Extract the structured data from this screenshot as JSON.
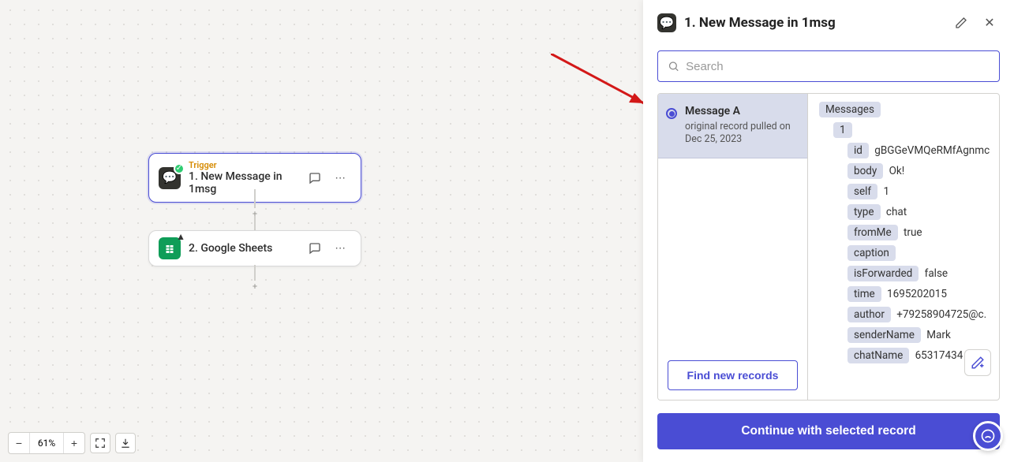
{
  "canvas": {
    "node1": {
      "label": "Trigger",
      "title": "1. New Message in 1msg",
      "icon_name": "onemsg-icon",
      "status": "ok"
    },
    "node2": {
      "title": "2. Google Sheets",
      "icon_name": "google-sheets-icon",
      "status": "warning"
    }
  },
  "zoom": {
    "minus": "−",
    "level": "61%",
    "plus": "+"
  },
  "panel": {
    "title": "1. New Message in 1msg",
    "search_placeholder": "Search",
    "record": {
      "title": "Message A",
      "subtitle": "original record pulled on Dec 25, 2023"
    },
    "find_button": "Find new records",
    "continue_button": "Continue with selected record",
    "data_root": "Messages",
    "data_index": "1",
    "kv": [
      {
        "k": "id",
        "v": "gBGGeVMQeRMfAgnmc"
      },
      {
        "k": "body",
        "v": "Ok!"
      },
      {
        "k": "self",
        "v": "1"
      },
      {
        "k": "type",
        "v": "chat"
      },
      {
        "k": "fromMe",
        "v": "true"
      },
      {
        "k": "caption",
        "v": ""
      },
      {
        "k": "isForwarded",
        "v": "false"
      },
      {
        "k": "time",
        "v": "1695202015"
      },
      {
        "k": "author",
        "v": "+79258904725@c."
      },
      {
        "k": "senderName",
        "v": "Mark"
      },
      {
        "k": "chatName",
        "v": "65317434"
      }
    ]
  }
}
